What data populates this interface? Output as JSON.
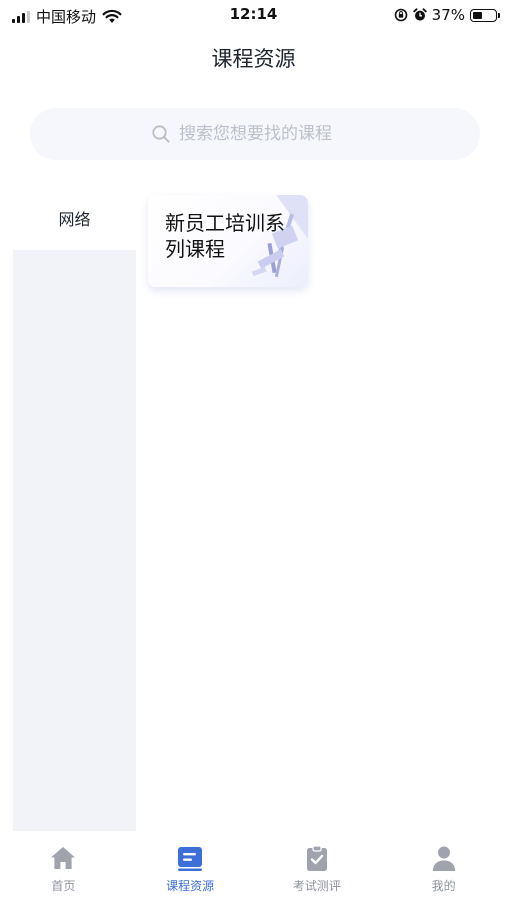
{
  "status_bar": {
    "carrier": "中国移动",
    "time": "12:14",
    "battery_percent": "37%",
    "battery_level": 0.37,
    "icons": [
      "signal-icon",
      "wifi-icon",
      "lock-rotation-icon",
      "alarm-icon",
      "battery-icon"
    ]
  },
  "header": {
    "title": "课程资源"
  },
  "search": {
    "placeholder": "搜索您想要找的课程",
    "value": "",
    "icon": "search-icon"
  },
  "categories": [
    {
      "label": "网络",
      "selected": true
    }
  ],
  "courses": [
    {
      "title": "新员工培训系列课程"
    }
  ],
  "tab_bar": {
    "active_tab": "课程资源",
    "active_color": "#3d6fd9",
    "inactive_color": "#8f949e",
    "tabs": [
      {
        "label": "首页",
        "icon": "home-icon"
      },
      {
        "label": "课程资源",
        "icon": "course-icon"
      },
      {
        "label": "考试测评",
        "icon": "exam-icon"
      },
      {
        "label": "我的",
        "icon": "profile-icon"
      }
    ]
  }
}
